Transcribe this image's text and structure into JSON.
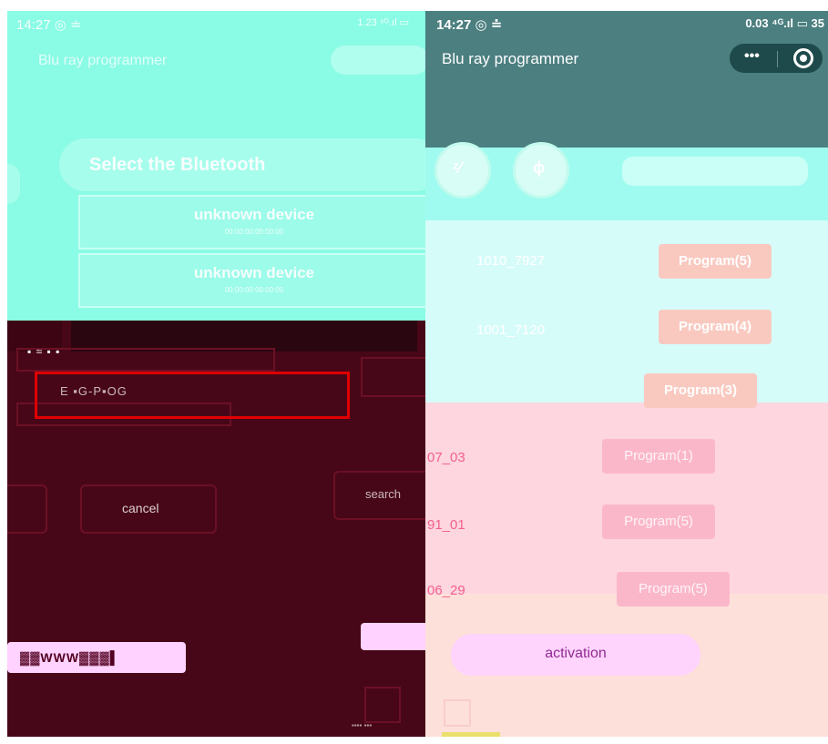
{
  "left": {
    "status_time": "14:27 ◎ ≐",
    "status_right": "1.23 ⁴ᴳ.ıl ▭",
    "app_title": "Blu ray programmer",
    "dialog_title": "Select the Bluetooth",
    "devices": [
      {
        "name": "unknown device",
        "mac": "00:00:00:00:00:00"
      },
      {
        "name": "unknown device",
        "mac": "00:00:00:00:00:00"
      }
    ],
    "dark_text": "▪︎ ≈ ▪︎ ▪︎",
    "highlight_text": "E ▪︎G-P▪︎OG",
    "cancel_label": "cancel",
    "search_label": "search",
    "bar_text": "▓▓WWW▓▓▓▌",
    "footer_label": "▪︎▪︎▪︎▪︎ ▪︎▪︎▪︎"
  },
  "right": {
    "status_time": "14:27 ◎ ≐",
    "status_right": "0.03 ⁴ᴳ.ıl ▭ 35",
    "app_title": "Blu ray programmer",
    "capsule_dots": "•••",
    "circles": [
      "ᶻ⁄",
      "ɸ"
    ],
    "rows": [
      {
        "id": "1010_7927",
        "program": "Program(5)"
      },
      {
        "id": "1001_7120",
        "program": "Program(4)"
      },
      {
        "id": "",
        "program": "Program(3)"
      },
      {
        "id": "07_03",
        "program": "Program(1)"
      },
      {
        "id": "91_01",
        "program": "Program(5)"
      },
      {
        "id": "06_29",
        "program": "Program(5)"
      }
    ],
    "activation_label": "activation"
  }
}
